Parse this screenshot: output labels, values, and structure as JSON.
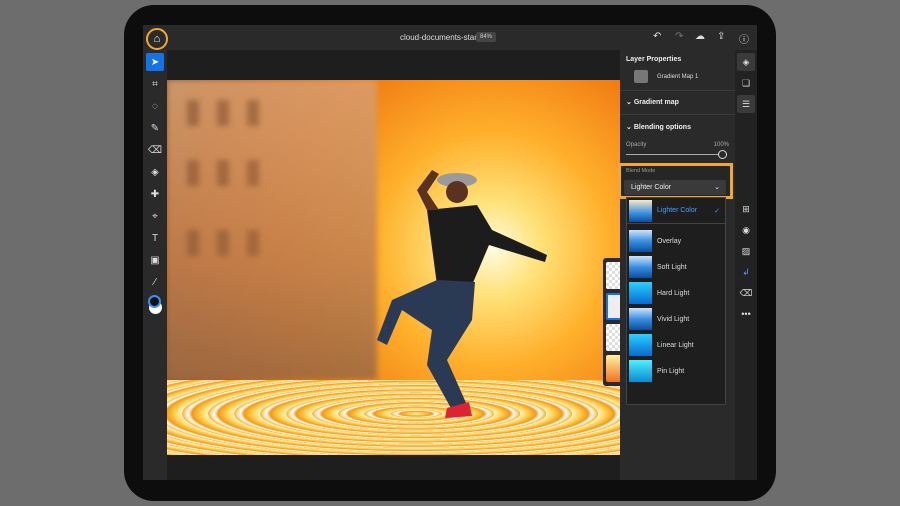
{
  "topbar": {
    "title": "cloud-documents-start",
    "zoom": "84%"
  },
  "panel": {
    "title": "Layer Properties",
    "layer_name": "Gradient Map 1",
    "section_gradient": "Gradient map",
    "section_blending": "Blending options",
    "opacity_label": "Opacity",
    "opacity_value": "100%",
    "opacity_fraction": 1.0,
    "blend_mode_label": "Blend Mode",
    "blend_mode_value": "Lighter Color",
    "blend_modes": [
      {
        "label": "Lighter Color",
        "selected": true
      },
      {
        "label": "Overlay"
      },
      {
        "label": "Soft Light"
      },
      {
        "label": "Hard Light"
      },
      {
        "label": "Vivid Light"
      },
      {
        "label": "Linear Light"
      },
      {
        "label": "Pin Light"
      }
    ]
  },
  "colors": {
    "accent": "#1473e6",
    "highlight": "#f0a830"
  }
}
